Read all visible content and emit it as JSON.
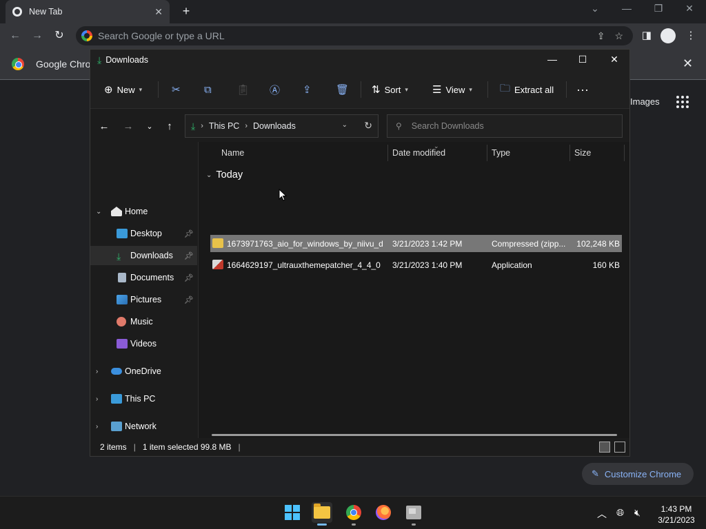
{
  "chrome": {
    "tab_title": "New Tab",
    "omnibox_placeholder": "Search Google or type a URL",
    "infobar_text": "Google Chrom",
    "images_link": "Images",
    "customize_label": "Customize Chrome"
  },
  "explorer": {
    "title": "Downloads",
    "commands": {
      "new": "New",
      "sort": "Sort",
      "view": "View",
      "extract_all": "Extract all"
    },
    "breadcrumb": [
      "This PC",
      "Downloads"
    ],
    "search_placeholder": "Search Downloads",
    "nav": {
      "home": "Home",
      "desktop": "Desktop",
      "downloads": "Downloads",
      "documents": "Documents",
      "pictures": "Pictures",
      "music": "Music",
      "videos": "Videos",
      "onedrive": "OneDrive",
      "thispc": "This PC",
      "network": "Network"
    },
    "columns": {
      "name": "Name",
      "date": "Date modified",
      "type": "Type",
      "size": "Size"
    },
    "group": "Today",
    "files": [
      {
        "name": "1673971763_aio_for_windows_by_niivu_d...",
        "date": "3/21/2023 1:42 PM",
        "type": "Compressed (zipp...",
        "size": "102,248 KB"
      },
      {
        "name": "1664629197_ultrauxthemepatcher_4_4_0",
        "date": "3/21/2023 1:40 PM",
        "type": "Application",
        "size": "160 KB"
      }
    ],
    "status": {
      "items": "2 items",
      "selected": "1 item selected  99.8 MB"
    }
  },
  "taskbar": {
    "time": "1:43 PM",
    "date": "3/21/2023"
  },
  "colors": {
    "accent": "#4cc2ff",
    "download_green": "#2fb46b",
    "chrome_link": "#8ab4f8"
  }
}
